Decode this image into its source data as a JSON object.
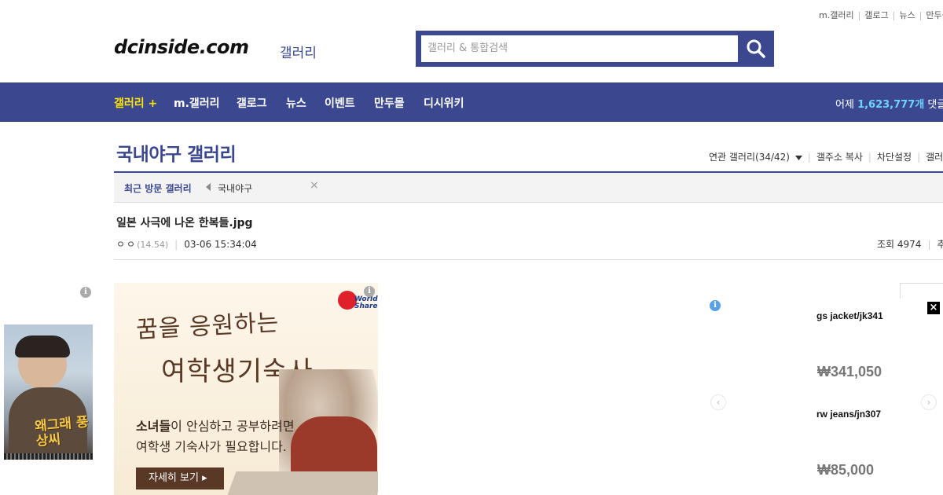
{
  "util_links": [
    "m.갤러리",
    "갤로그",
    "뉴스",
    "만두몰"
  ],
  "logo": {
    "text": "dcinside.com",
    "sub": "갤러리"
  },
  "search": {
    "placeholder": "갤러리 & 통합검색",
    "icon": "search-icon"
  },
  "nav": {
    "items": [
      "갤러리 +",
      "m.갤러리",
      "갤로그",
      "뉴스",
      "이벤트",
      "만두몰",
      "디시위키"
    ],
    "stats_prefix": "어제",
    "stats_number": "1,623,777개",
    "stats_suffix": "댓글"
  },
  "gallery": {
    "title": "국내야구 갤러리",
    "tools": [
      "연관 갤러리(34/42)",
      "갤주소 복사",
      "차단설정",
      "갤러"
    ]
  },
  "recent": {
    "label": "최근 방문 갤러리",
    "item": "국내야구",
    "close": "×"
  },
  "post": {
    "title": "일본 사극에 나온 한복들.jpg",
    "author": "ㅇㅇ",
    "ip": "(14.54)",
    "datetime": "03-06 15:34:04",
    "views": "조회 4974",
    "recommend": "추"
  },
  "ads": {
    "poster_title": "왜그래 풍상씨",
    "banner": {
      "headline_a": "꿈을 응원하는",
      "headline_b": "여학생기숙사",
      "body_line1_bold": "소녀들",
      "body_line1_rest": "이 안심하고 공부하려면",
      "body_line2": "여학생 기숙사가 필요합니다.",
      "button": "자세히 보기 ▸",
      "logo_text": "World Share"
    },
    "products": [
      {
        "name": "gs jacket/jk341",
        "price": "₩341,050"
      },
      {
        "name": "rw jeans/jn307",
        "price": "₩85,000"
      }
    ],
    "info_icon": "i",
    "close_icon": "×"
  },
  "colors": {
    "brand": "#3b4890",
    "nav_highlight": "#ffe600",
    "stats_number": "#6dd3ff"
  }
}
